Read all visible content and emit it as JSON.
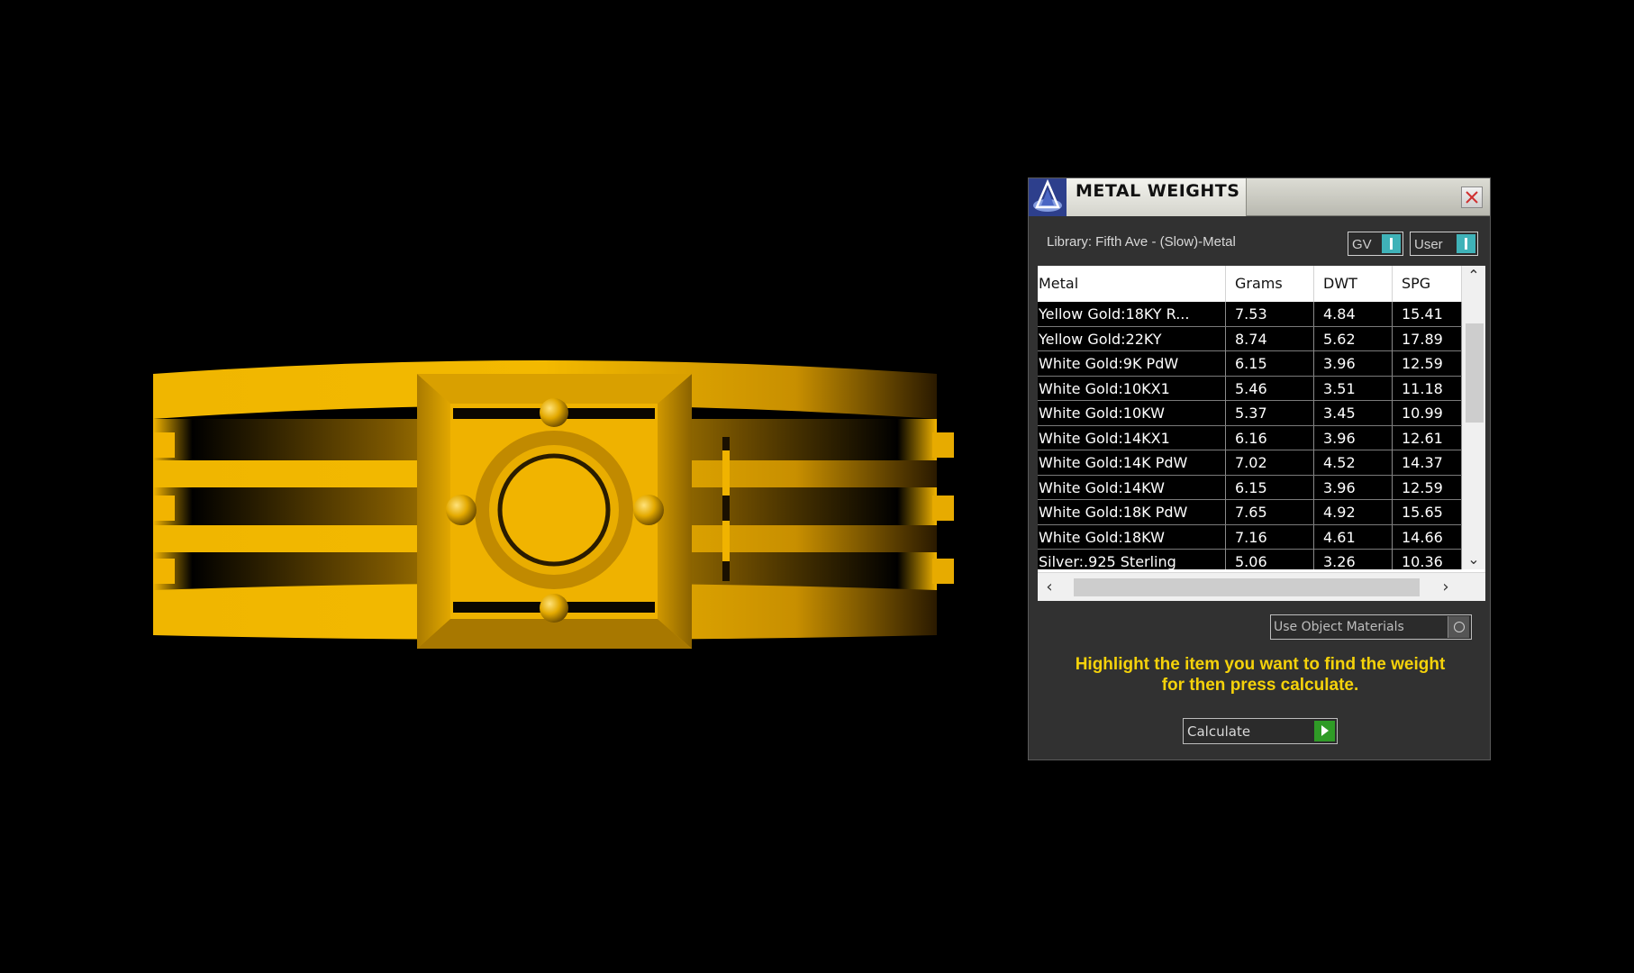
{
  "panel": {
    "title": "METAL WEIGHTS",
    "close_symbol": "✕",
    "library_label": "Library: Fifth Ave - (Slow)-Metal",
    "toggles": {
      "gv_label": "GV",
      "user_label": "User"
    },
    "table": {
      "columns": [
        "Metal",
        "Grams",
        "DWT",
        "SPG"
      ],
      "rows": [
        {
          "metal": "Yellow Gold:18KY R...",
          "grams": "7.53",
          "dwt": "4.84",
          "spg": "15.41"
        },
        {
          "metal": "Yellow Gold:22KY",
          "grams": "8.74",
          "dwt": "5.62",
          "spg": "17.89"
        },
        {
          "metal": "White Gold:9K PdW",
          "grams": "6.15",
          "dwt": "3.96",
          "spg": "12.59"
        },
        {
          "metal": "White Gold:10KX1",
          "grams": "5.46",
          "dwt": "3.51",
          "spg": "11.18"
        },
        {
          "metal": "White Gold:10KW",
          "grams": "5.37",
          "dwt": "3.45",
          "spg": "10.99"
        },
        {
          "metal": "White Gold:14KX1",
          "grams": "6.16",
          "dwt": "3.96",
          "spg": "12.61"
        },
        {
          "metal": "White Gold:14K PdW",
          "grams": "7.02",
          "dwt": "4.52",
          "spg": "14.37"
        },
        {
          "metal": "White Gold:14KW",
          "grams": "6.15",
          "dwt": "3.96",
          "spg": "12.59"
        },
        {
          "metal": "White Gold:18K PdW",
          "grams": "7.65",
          "dwt": "4.92",
          "spg": "15.65"
        },
        {
          "metal": "White Gold:18KW",
          "grams": "7.16",
          "dwt": "4.61",
          "spg": "14.66"
        },
        {
          "metal": "Silver:.925 Sterling",
          "grams": "5.06",
          "dwt": "3.26",
          "spg": "10.36"
        }
      ]
    },
    "scroll_up_symbol": "⌃",
    "scroll_down_symbol": "⌄",
    "scroll_left_symbol": "‹",
    "scroll_right_symbol": "›",
    "use_object_materials_label": "Use Object Materials",
    "hint_line1": "Highlight the item you want to find the weight",
    "hint_line2": "for then press calculate.",
    "calculate_label": "Calculate"
  },
  "colors": {
    "ring_gold": "#e8b000",
    "hint_yellow": "#f5d20a",
    "toggle_teal": "#3fb2b8",
    "go_green": "#2f9b26"
  }
}
